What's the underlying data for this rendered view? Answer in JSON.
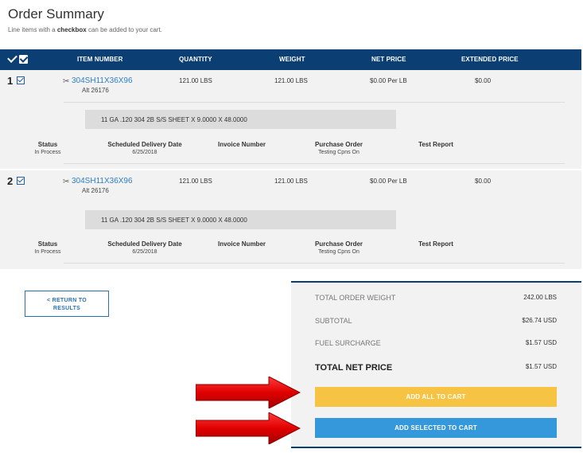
{
  "page": {
    "title": "Order Summary",
    "subtitle_pre": "Line items with a ",
    "subtitle_bold": "checkbox",
    "subtitle_post": " can be added to your cart."
  },
  "table_header": {
    "item_number": "ITEM NUMBER",
    "quantity": "QUANTITY",
    "weight": "WEIGHT",
    "net_price": "NET PRICE",
    "extended_price": "EXTENDED PRICE"
  },
  "meta_labels": {
    "status": "Status",
    "scheduled_delivery": "Scheduled Delivery Date",
    "invoice_number": "Invoice Number",
    "purchase_order": "Purchase Order",
    "test_report": "Test Report"
  },
  "lines": [
    {
      "number": "1",
      "item": "304SH11X36X96",
      "alt": "Alt 26176",
      "quantity": "121.00 LBS",
      "weight": "121.00 LBS",
      "net_price": "$0.00 Per LB",
      "extended_price": "$0.00",
      "description": "11 GA .120 304 2B S/S SHEET X 9.0000 X 48.0000",
      "status": "In Process",
      "delivery_date": "6/25/2018",
      "invoice_number": "",
      "purchase_order": "Testing Cpns On",
      "test_report": ""
    },
    {
      "number": "2",
      "item": "304SH11X36X96",
      "alt": "Alt 26176",
      "quantity": "121.00 LBS",
      "weight": "121.00 LBS",
      "net_price": "$0.00 Per LB",
      "extended_price": "$0.00",
      "description": "11 GA .120 304 2B S/S SHEET X 9.0000 X 48.0000",
      "status": "In Process",
      "delivery_date": "6/25/2018",
      "invoice_number": "",
      "purchase_order": "Testing Cpns On",
      "test_report": ""
    }
  ],
  "return_button": {
    "line1": "< RETURN TO",
    "line2": "RESULTS"
  },
  "summary": {
    "total_weight_label": "TOTAL ORDER WEIGHT",
    "total_weight_value": "242.00 LBS",
    "subtotal_label": "SUBTOTAL",
    "subtotal_value": "$26.74 USD",
    "fuel_label": "FUEL SURCHARGE",
    "fuel_value": "$1.57 USD",
    "total_label": "TOTAL NET PRICE",
    "total_value": "$1.57 USD",
    "add_all_label": "ADD ALL TO CART",
    "add_selected_label": "ADD SELECTED TO CART"
  },
  "colors": {
    "header_bg": "#0b3e72",
    "link": "#2f7ec4",
    "add_all": "#f6c343",
    "add_selected": "#3498db",
    "arrow": "#e01010"
  },
  "icons": [
    "check-all-icon",
    "checkbox-icon",
    "scissors-icon",
    "arrow-right-icon"
  ]
}
